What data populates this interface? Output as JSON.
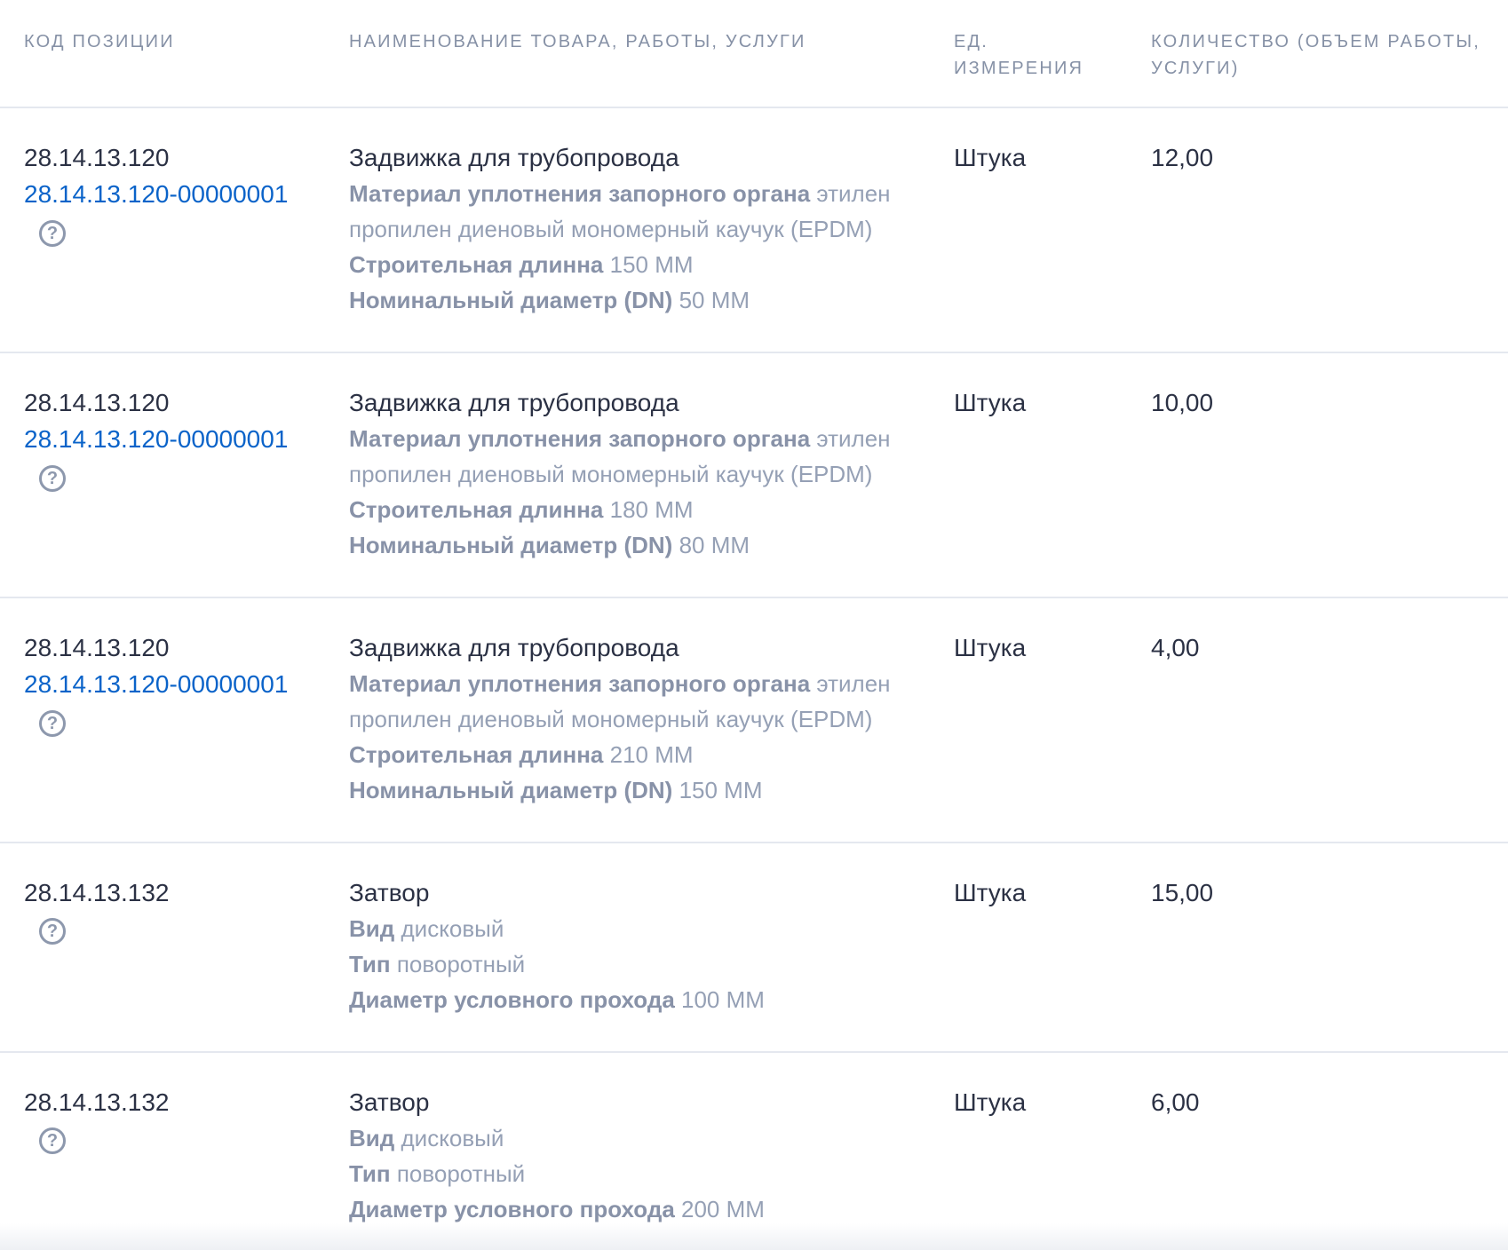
{
  "headers": {
    "code": "КОД ПОЗИЦИИ",
    "name": "НАИМЕНОВАНИЕ ТОВАРА, РАБОТЫ, УСЛУГИ",
    "unit_line1": "ЕД.",
    "unit_line2": "ИЗМЕРЕНИЯ",
    "qty_line1": "КОЛИЧЕСТВО (ОБЪЕМ РАБОТЫ,",
    "qty_line2": "УСЛУГИ)"
  },
  "help_icon_glyph": "?",
  "rows": [
    {
      "okpd": "28.14.13.120",
      "ktru": "28.14.13.120-00000001",
      "title": "Задвижка для трубопровода",
      "attrs": [
        {
          "name": "Материал уплотнения запорного органа",
          "value": "этилен пропилен диеновый мономерный каучук (EPDM)"
        },
        {
          "name": "Строительная длинна",
          "value": "150 ММ"
        },
        {
          "name": "Номинальный диаметр (DN)",
          "value": "50 ММ"
        }
      ],
      "unit": "Штука",
      "qty": "12,00"
    },
    {
      "okpd": "28.14.13.120",
      "ktru": "28.14.13.120-00000001",
      "title": "Задвижка для трубопровода",
      "attrs": [
        {
          "name": "Материал уплотнения запорного органа",
          "value": "этилен пропилен диеновый мономерный каучук (EPDM)"
        },
        {
          "name": "Строительная длинна",
          "value": "180 ММ"
        },
        {
          "name": "Номинальный диаметр (DN)",
          "value": "80 ММ"
        }
      ],
      "unit": "Штука",
      "qty": "10,00"
    },
    {
      "okpd": "28.14.13.120",
      "ktru": "28.14.13.120-00000001",
      "title": "Задвижка для трубопровода",
      "attrs": [
        {
          "name": "Материал уплотнения запорного органа",
          "value": "этилен пропилен диеновый мономерный каучук (EPDM)"
        },
        {
          "name": "Строительная длинна",
          "value": "210 ММ"
        },
        {
          "name": "Номинальный диаметр (DN)",
          "value": "150 ММ"
        }
      ],
      "unit": "Штука",
      "qty": "4,00"
    },
    {
      "okpd": "28.14.13.132",
      "ktru": "",
      "title": "Затвор",
      "attrs": [
        {
          "name": "Вид",
          "value": "дисковый"
        },
        {
          "name": "Тип",
          "value": "поворотный"
        },
        {
          "name": "Диаметр условного прохода",
          "value": "100 ММ"
        }
      ],
      "unit": "Штука",
      "qty": "15,00"
    },
    {
      "okpd": "28.14.13.132",
      "ktru": "",
      "title": "Затвор",
      "attrs": [
        {
          "name": "Вид",
          "value": "дисковый"
        },
        {
          "name": "Тип",
          "value": "поворотный"
        },
        {
          "name": "Диаметр условного прохода",
          "value": "200 ММ"
        }
      ],
      "unit": "Штука",
      "qty": "6,00"
    }
  ]
}
